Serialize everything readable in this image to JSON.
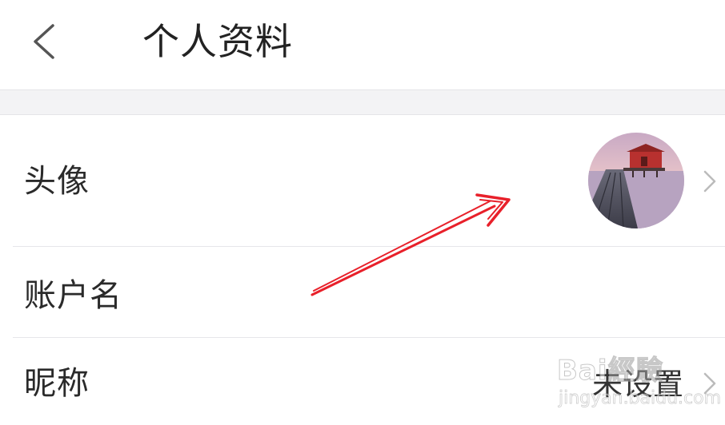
{
  "header": {
    "back_icon": "chevron-left-icon",
    "title": "个人资料"
  },
  "rows": [
    {
      "label": "头像",
      "value": "",
      "trailing_icon": "chevron-right-icon",
      "avatar_icon": "avatar-photo-pier-house"
    },
    {
      "label": "账户名",
      "value": "",
      "trailing_icon": ""
    },
    {
      "label": "昵称",
      "value": "未设置",
      "trailing_icon": "chevron-right-icon"
    }
  ],
  "annotation": {
    "arrow_color": "#e8202a",
    "icon": "red-arrow-icon"
  },
  "watermark": {
    "brand": "Bai經驗",
    "site": "jingyan.baidu.com"
  },
  "colors": {
    "background": "#ffffff",
    "separator": "#f3f3f5",
    "divider": "#e6e6ea",
    "chevron": "#bbbbbb",
    "text": "#222222"
  }
}
